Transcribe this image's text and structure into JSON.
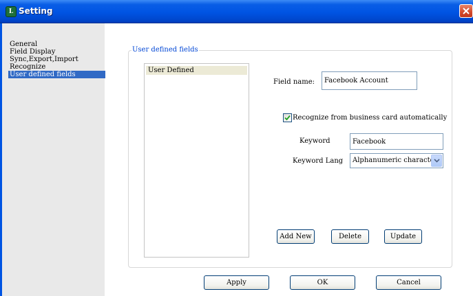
{
  "window": {
    "title": "Setting",
    "app_icon_glyph": "L"
  },
  "sidebar": {
    "items": [
      {
        "label": "General",
        "selected": false
      },
      {
        "label": "Field Display",
        "selected": false
      },
      {
        "label": "Sync,Export,Import",
        "selected": false
      },
      {
        "label": "Recognize",
        "selected": false
      },
      {
        "label": "User defined fields",
        "selected": true
      }
    ]
  },
  "panel": {
    "group_title": "User defined fields",
    "list": {
      "items": [
        "User Defined"
      ]
    },
    "field_name": {
      "label": "Field name:",
      "value": "Facebook Account"
    },
    "recognize_checkbox": {
      "label": "Recognize from business card automatically",
      "checked": true
    },
    "keyword": {
      "label": "Keyword",
      "value": "Facebook"
    },
    "keyword_lang": {
      "label": "Keyword Lang",
      "value": "Alphanumeric characters"
    },
    "buttons": {
      "add_new": "Add New",
      "delete": "Delete",
      "update": "Update"
    }
  },
  "footer": {
    "apply": "Apply",
    "ok": "OK",
    "cancel": "Cancel"
  },
  "colors": {
    "titlebar": "#0054e3",
    "selection": "#316ac5",
    "legend": "#0046d5",
    "close": "#d3482b"
  }
}
